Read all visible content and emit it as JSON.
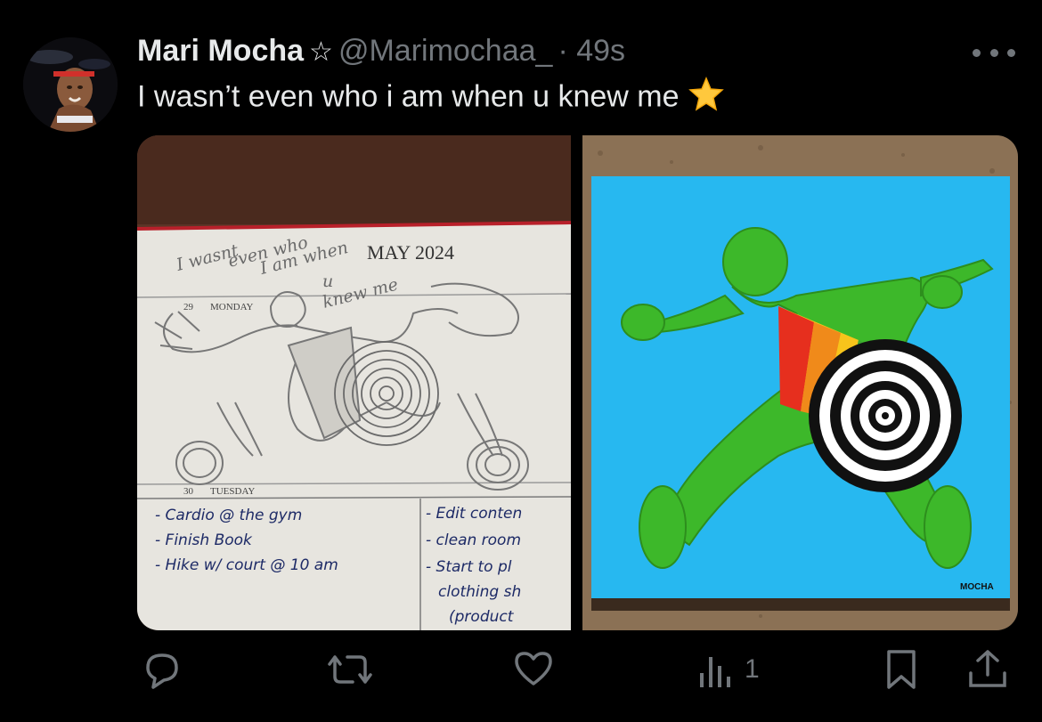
{
  "post": {
    "display_name": "Mari Mocha",
    "badge": "☆",
    "handle": "@Marimochaa_",
    "time": "· 49s",
    "text": "I wasn’t even who i am when u knew me",
    "emoji_name": "star-emoji"
  },
  "media": {
    "planner": {
      "month": "MAY 2024",
      "day1_num": "29",
      "day1": "MONDAY",
      "day2_num": "30",
      "day2": "TUESDAY",
      "scribble": [
        "I wasnt",
        "even who",
        "I am when",
        "u",
        "knew me"
      ],
      "todo_left": [
        "- Cardio @ the gym",
        "- Finish Book",
        "- Hike w/ court @ 10 am"
      ],
      "todo_right": [
        "- Edit conten",
        "- clean room",
        "- Start to pl",
        "clothing sh",
        "(product"
      ]
    },
    "painting": {
      "signature": "MOCHA"
    }
  },
  "actions": {
    "reply_icon": "reply-icon",
    "repost_icon": "repost-icon",
    "like_icon": "heart-icon",
    "views_icon": "views-icon",
    "views_count": "1",
    "bookmark_icon": "bookmark-icon",
    "share_icon": "share-icon"
  },
  "colors": {
    "background": "#000000",
    "text": "#e7e9ea",
    "muted": "#71767b",
    "painting_sky": "#27b8f0",
    "figure_green": "#3db82a"
  }
}
